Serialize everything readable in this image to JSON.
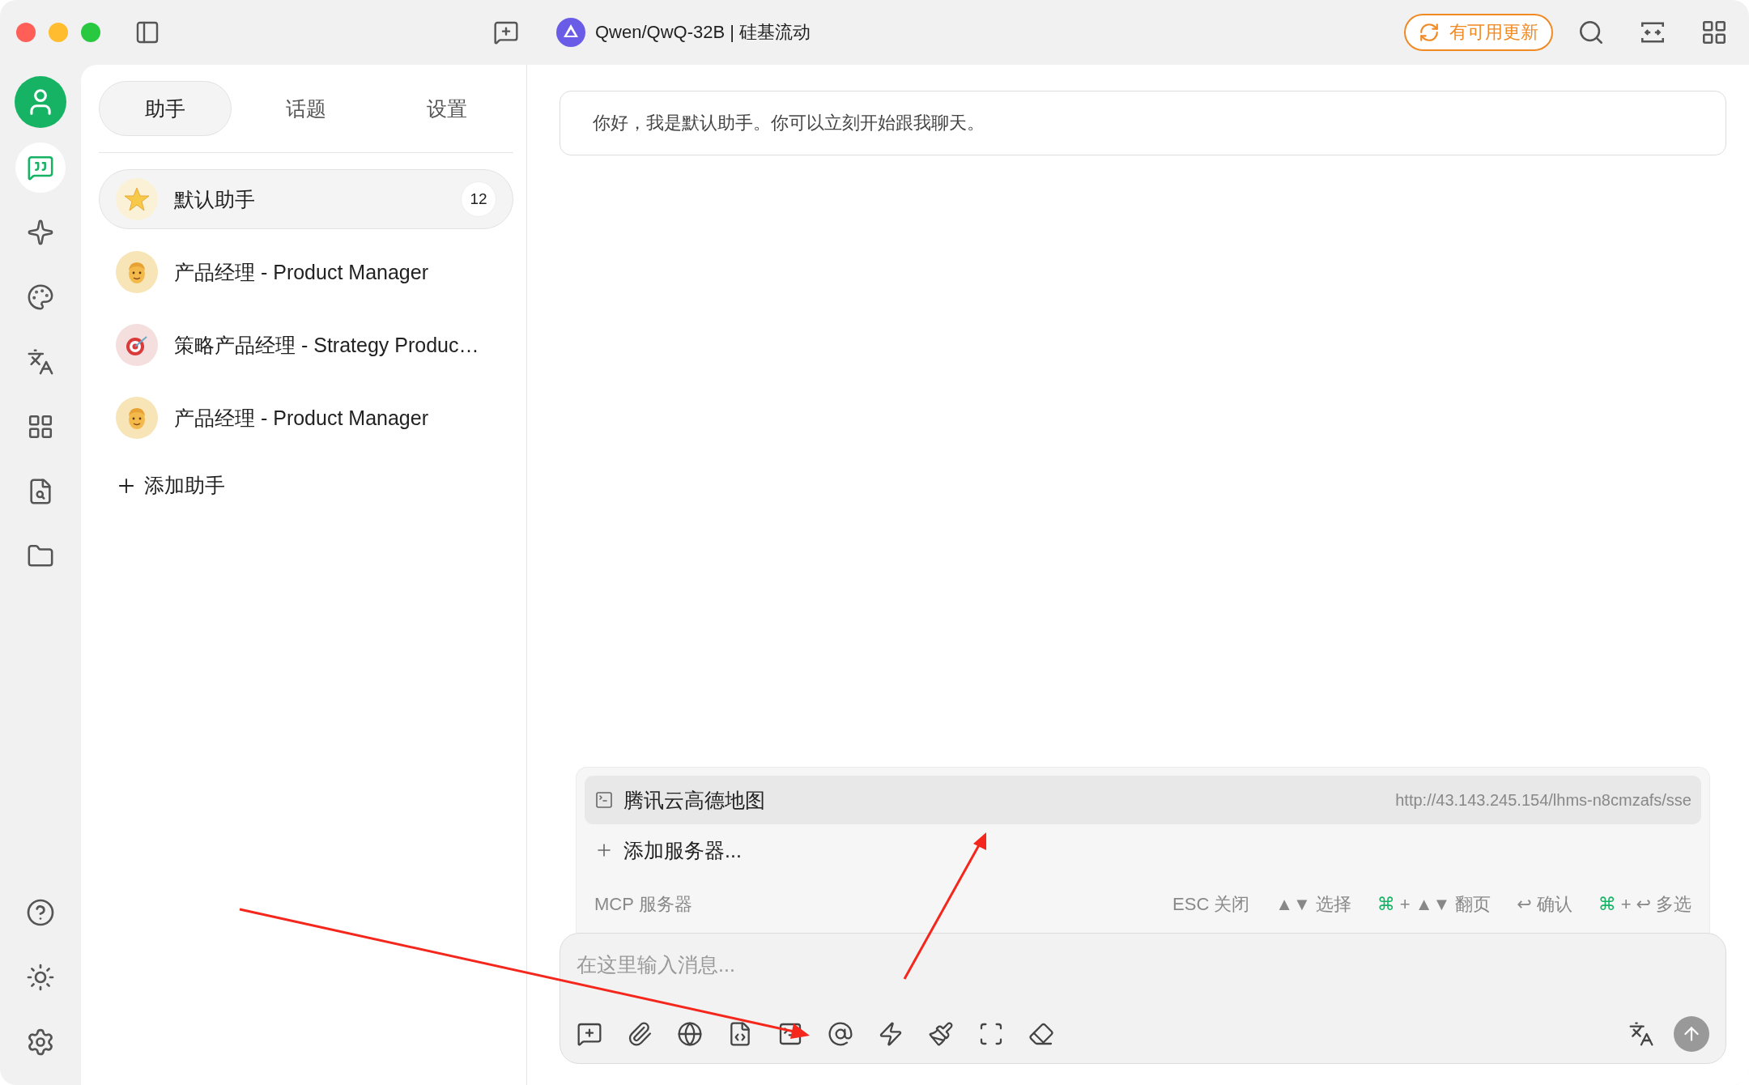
{
  "titlebar": {
    "model": "Qwen/QwQ-32B | 硅基流动",
    "update_button": "有可用更新"
  },
  "nav_items": [
    {
      "selected": true
    },
    {
      "selected": false
    },
    {
      "selected": false
    },
    {
      "selected": false
    },
    {
      "selected": false
    },
    {
      "selected": false
    },
    {
      "selected": false
    }
  ],
  "tabs": [
    {
      "label": "助手",
      "selected": true
    },
    {
      "label": "话题",
      "selected": false
    },
    {
      "label": "设置",
      "selected": false
    }
  ],
  "assistants": [
    {
      "name": "默认助手",
      "kind": "star",
      "selected": true,
      "count": "12"
    },
    {
      "name": "产品经理 - Product Manager",
      "kind": "person",
      "selected": false
    },
    {
      "name": "策略产品经理 - Strategy Produc…",
      "kind": "target",
      "selected": false
    },
    {
      "name": "产品经理 - Product Manager",
      "kind": "person",
      "selected": false
    }
  ],
  "add_assistant": "添加助手",
  "greeting": "你好，我是默认助手。你可以立刻开始跟我聊天。",
  "mcp_popup": {
    "servers": [
      {
        "name": "腾讯云高德地图",
        "url": "http://43.143.245.154/lhms-n8cmzafs/sse",
        "selected": true
      }
    ],
    "add_server": "添加服务器...",
    "title": "MCP 服务器",
    "hints": [
      {
        "keys": [
          {
            "text": "ESC",
            "accent": false
          }
        ],
        "label": "关闭"
      },
      {
        "keys": [
          {
            "text": "▲▼",
            "accent": false
          }
        ],
        "label": "选择"
      },
      {
        "keys": [
          {
            "text": "⌘",
            "accent": true
          },
          {
            "text": "+",
            "accent": false
          },
          {
            "text": "▲▼",
            "accent": false
          }
        ],
        "label": "翻页"
      },
      {
        "keys": [
          {
            "text": "↩",
            "accent": false
          }
        ],
        "label": "确认"
      },
      {
        "keys": [
          {
            "text": "⌘",
            "accent": true
          },
          {
            "text": "+",
            "accent": false
          },
          {
            "text": "↩",
            "accent": false
          }
        ],
        "label": "多选"
      }
    ]
  },
  "input": {
    "placeholder": "在这里输入消息..."
  }
}
